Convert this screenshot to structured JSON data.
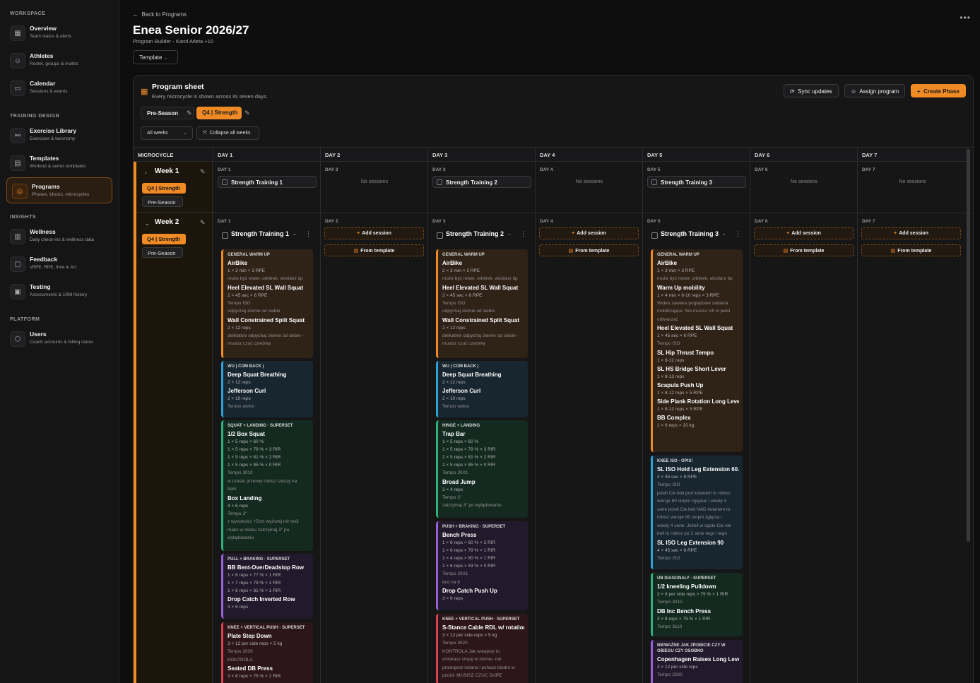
{
  "sidebar": {
    "workspace": "WORKSPACE",
    "training_design": "TRAINING DESIGN",
    "insights": "INSIGHTS",
    "platform": "PLATFORM",
    "items": [
      {
        "label": "Overview",
        "sub": "Team status & alerts",
        "icon": "grid-icon"
      },
      {
        "label": "Athletes",
        "sub": "Roster, groups & invites",
        "icon": "users-icon"
      },
      {
        "label": "Calendar",
        "sub": "Sessions & events",
        "icon": "calendar-icon"
      },
      {
        "label": "Exercise Library",
        "sub": "Exercises & taxonomy",
        "icon": "dumbbell-icon"
      },
      {
        "label": "Templates",
        "sub": "Workout & series templates",
        "icon": "template-icon"
      },
      {
        "label": "Programs",
        "sub": "Phases, blocks, microcycles",
        "icon": "target-icon"
      },
      {
        "label": "Wellness",
        "sub": "Daily check-ins & wellness data",
        "icon": "chart-icon"
      },
      {
        "label": "Feedback",
        "sub": "sRPE, RPE, time & AU",
        "icon": "message-icon"
      },
      {
        "label": "Testing",
        "sub": "Assessments & 1RM history",
        "icon": "clipboard-icon"
      },
      {
        "label": "Users",
        "sub": "Coach accounts & billing status",
        "icon": "shield-icon"
      }
    ]
  },
  "header": {
    "back": "Back to Programs",
    "title": "Enea Senior 2026/27",
    "subtitle": "Program Builder - Karol Atleta +10",
    "template": "Template"
  },
  "sheet": {
    "title": "Program sheet",
    "subtitle": "Every microcycle is shown across its seven days.",
    "sync": "Sync updates",
    "assign": "Assign program",
    "create": "Create Phase",
    "phase_a": "Pre-Season",
    "phase_b": "Q4 | Strength",
    "weeks_filter": "All weeks",
    "collapse": "Collapse all weeks"
  },
  "columns": [
    "MICROCYCLE",
    "DAY 1",
    "DAY 2",
    "DAY 3",
    "DAY 4",
    "DAY 5",
    "DAY 6",
    "DAY 7"
  ],
  "week1": {
    "label": "Week 1",
    "tag1": "Q4 | Strength",
    "tag2": "Pre-Season",
    "days": [
      "DAY 1",
      "DAY 2",
      "DAY 3",
      "DAY 4",
      "DAY 5",
      "DAY 6",
      "DAY 7"
    ],
    "s1": "Strength Training 1",
    "s2": "Strength Training 2",
    "s3": "Strength Training 3",
    "none": "No sessions"
  },
  "week2": {
    "label": "Week 2",
    "tag1": "Q4 | Strength",
    "tag2": "Pre-Season",
    "days": [
      "DAY 1",
      "DAY 2",
      "DAY 3",
      "DAY 4",
      "DAY 5",
      "DAY 6",
      "DAY 7"
    ],
    "add": "Add session",
    "from": "From template",
    "d1": {
      "title": "Strength Training 1"
    },
    "d3": {
      "title": "Strength Training 2"
    },
    "d5": {
      "title": "Strength Training 3"
    }
  },
  "blocks": {
    "d1b1": {
      "head": "GENERAL WARM UP",
      "lines": [
        [
          "ex",
          "AirBike"
        ],
        [
          "ln",
          "1 × 3 min × 3 RPE"
        ],
        [
          "nt",
          "może być rower, orbitrek, wioślarz itp"
        ],
        [
          "ex",
          "Heel Elevated SL Wall Squat"
        ],
        [
          "ln",
          "2 × 45 sec × 6 RPE"
        ],
        [
          "nt",
          "Tempo ISO"
        ],
        [
          "nt",
          "odpychaj ziemie od siebie"
        ],
        [
          "ex",
          "Wall Constrained Split Squat"
        ],
        [
          "ln",
          "2 × 12 reps"
        ],
        [
          "nt",
          "delikatnie odpychaj ziemie od siebie -"
        ],
        [
          "nt",
          "musisz czuć czwórkę"
        ]
      ]
    },
    "d1b2": {
      "head": "WU | COM BACK |",
      "lines": [
        [
          "ex",
          "Deep Squat Breathing"
        ],
        [
          "ln",
          "2 × 12 reps"
        ],
        [
          "ex",
          "Jefferson Curl"
        ],
        [
          "ln",
          "2 × 10 reps"
        ],
        [
          "nt",
          "Tempo wolno"
        ]
      ]
    },
    "d1b3": {
      "head": "SQUAT + LANDING · SUPERSET",
      "lines": [
        [
          "ex",
          "1/2 Box Squat"
        ],
        [
          "ln",
          "1 × 5 reps × 60 %"
        ],
        [
          "ln",
          "1 × 5 reps × 79 % × 3 RIR"
        ],
        [
          "ln",
          "1 × 5 reps × 81 % × 2 RIR"
        ],
        [
          "ln",
          "1 × 5 reps × 85 % × 0 RIR"
        ],
        [
          "nt",
          "Tempo 3010"
        ],
        [
          "nt",
          "w czasie przerwy robisz rzeczy na"
        ],
        [
          "nt",
          "bark"
        ],
        [
          "ex",
          "Box Landing"
        ],
        [
          "ln",
          "4 × 6 reps"
        ],
        [
          "nt",
          "Tempo 3\""
        ],
        [
          "nt",
          "z wysokości +5cm wyższej niż twój"
        ],
        [
          "nt",
          "maks w skoku zatrzymaj 3\" po"
        ],
        [
          "nt",
          "wylądowaniu"
        ]
      ]
    },
    "d1b4": {
      "head": "PULL + BRAKING · SUPERSET",
      "lines": [
        [
          "ex",
          "BB Bent-OverDeadstop Row"
        ],
        [
          "ln",
          "1 × 8 reps × 77 % × 1 RIR"
        ],
        [
          "ln",
          "1 × 7 reps × 79 % × 1 RIR"
        ],
        [
          "ln",
          "1 × 6 reps × 81 % × 1 RIR"
        ],
        [
          "ex",
          "Drop Catch Inverted Row"
        ],
        [
          "ln",
          "3 × 6 reps"
        ]
      ]
    },
    "d1b5": {
      "head": "KNEE + VERTICAL PUSH · SUPERSET",
      "lines": [
        [
          "ex",
          "Plate Step Down"
        ],
        [
          "ln",
          "3 × 12 per side reps × 5 kg"
        ],
        [
          "nt",
          "Tempo 2020"
        ],
        [
          "nt",
          "KONTROLA"
        ],
        [
          "ex",
          "Seated DB Press"
        ],
        [
          "ln",
          "3 × 8 reps × 75 % × 2 RIR"
        ]
      ]
    },
    "d3b1": {
      "head": "GENERAL WARM UP",
      "lines": [
        [
          "ex",
          "AirBike"
        ],
        [
          "ln",
          "2 × 3 min × 3 RPE"
        ],
        [
          "nt",
          "może być rower, orbitrek, wioślarz itp"
        ],
        [
          "ex",
          "Heel Elevated SL Wall Squat"
        ],
        [
          "ln",
          "2 × 45 sec × 6 RPE"
        ],
        [
          "nt",
          "Tempo ISO"
        ],
        [
          "nt",
          "odpychaj ziemie od siebie"
        ],
        [
          "ex",
          "Wall Constrained Split Squat"
        ],
        [
          "ln",
          "2 × 12 reps"
        ],
        [
          "nt",
          "delikatnie odpychaj ziemie od siebie -"
        ],
        [
          "nt",
          "musisz czuć czwórkę"
        ]
      ]
    },
    "d3b2": {
      "head": "WU | COM BACK |",
      "lines": [
        [
          "ex",
          "Deep Squat Breathing"
        ],
        [
          "ln",
          "2 × 12 reps"
        ],
        [
          "ex",
          "Jefferson Curl"
        ],
        [
          "ln",
          "2 × 10 reps"
        ],
        [
          "nt",
          "Tempo wolno"
        ]
      ]
    },
    "d3b3": {
      "head": "HINGE + LANDING",
      "lines": [
        [
          "ex",
          "Trap Bar"
        ],
        [
          "ln",
          "1 × 5 reps × 60 %"
        ],
        [
          "ln",
          "1 × 5 reps × 79 % × 3 RIR"
        ],
        [
          "ln",
          "1 × 5 reps × 81 % × 2 RIR"
        ],
        [
          "ln",
          "1 × 5 reps × 85 % × 0 RIR"
        ],
        [
          "nt",
          "Tempo 20X1"
        ],
        [
          "ex",
          "Broad Jump"
        ],
        [
          "ln",
          "3 × 4 reps"
        ],
        [
          "nt",
          "Tempo 3\""
        ],
        [
          "nt",
          "zatrzymaj 3\" po wylądowaniu"
        ]
      ]
    },
    "d3b4": {
      "head": "PUSH + BRAKING · SUPERSET",
      "lines": [
        [
          "ex",
          "Bench Press"
        ],
        [
          "ln",
          "1 × 6 reps × 60 % × 2 RIR"
        ],
        [
          "ln",
          "1 × 6 reps × 79 % × 1 RIR"
        ],
        [
          "ln",
          "1 × 4 reps × 80 % × 1 RIR"
        ],
        [
          "ln",
          "1 × 6 reps × 83 % × 0 RIR"
        ],
        [
          "nt",
          "Tempo 20X1"
        ],
        [
          "nt",
          "test na 6"
        ],
        [
          "ex",
          "Drop Catch Push Up"
        ],
        [
          "ln",
          "3 × 6 reps"
        ]
      ]
    },
    "d3b5": {
      "head": "KNEE + VERTICAL PUSH · SUPERSET",
      "lines": [
        [
          "ex",
          "S-Stance Cable RDL w/ rotation"
        ],
        [
          "ln",
          "3 × 12 per side reps × 5 kg"
        ],
        [
          "nt",
          "Tempo 3020"
        ],
        [
          "nt",
          "KONTROLA Jak wstajesz to"
        ],
        [
          "nt",
          "wciskasz stopę w ziemie- nie"
        ],
        [
          "nt",
          "prostujesz kolana i pchasz biodro w"
        ],
        [
          "nt",
          "przód- MUSISZ CZUC DUPE"
        ]
      ]
    },
    "d5b1": {
      "head": "GENERAL WARM UP",
      "lines": [
        [
          "ex",
          "AirBike"
        ],
        [
          "ln",
          "1 × 3 min × 3 RPE"
        ],
        [
          "nt",
          "może być rower, orbitrek, wioślarz itp"
        ],
        [
          "ex",
          "Warm Up mobility"
        ],
        [
          "ln",
          "1 × 4 min × 6-10 reps × 3 RPE"
        ],
        [
          "nt",
          "Wideo zawiera poglądowe zadania"
        ],
        [
          "nt",
          "mobilizujące. Nie musisz ich w pełni"
        ],
        [
          "nt",
          "odtwarzać"
        ],
        [
          "ex",
          "Heel Elevated SL Wall Squat"
        ],
        [
          "ln",
          "1 × 45 sec × 6 RPE"
        ],
        [
          "nt",
          "Tempo ISO"
        ],
        [
          "ex",
          "SL Hip Thrust Tempo"
        ],
        [
          "ln",
          "1 × 8-12 reps"
        ],
        [
          "ex",
          "SL HS Bridge Short Lever"
        ],
        [
          "ln",
          "1 × 8-12 reps"
        ],
        [
          "ex",
          "Scapula Push Up"
        ],
        [
          "ln",
          "1 × 8-12 reps × 5 RPE"
        ],
        [
          "ex",
          "Side Plank Rotation Long Lever"
        ],
        [
          "ln",
          "1 × 8-12 reps × 5 RPE"
        ],
        [
          "ex",
          "BB Complex"
        ],
        [
          "ln",
          "1 × 6 reps × 20 kg"
        ]
      ]
    },
    "d5b2": {
      "head": "KNEE ISO - OPIS!",
      "lines": [
        [
          "ex",
          "SL ISO Hold Leg Extension 60..."
        ],
        [
          "ln",
          "4 × 45 sec × 8 RPE"
        ],
        [
          "nt",
          "Tempo ISO"
        ],
        [
          "nt",
          "jeżeli Cie boli pod kolanem to robisz"
        ],
        [
          "nt",
          "wersje 60 stopni zgięcia! i wtedy 4"
        ],
        [
          "nt",
          "serie jeżeli Cie boli NAD kolanem to"
        ],
        [
          "nt",
          "robisz wersje 90 stopni zgięcia i"
        ],
        [
          "nt",
          "wtedy 4 serie. Jeżeli w ogóle Cie nie"
        ],
        [
          "nt",
          "boli to robisz po 2 serie tego i tego"
        ],
        [
          "ex",
          "SL ISO Leg Extension 90"
        ],
        [
          "ln",
          "4 × 45 sec × 8 RPE"
        ],
        [
          "nt",
          "Tempo ISO"
        ]
      ]
    },
    "d5b3": {
      "head": "UB DIAGONALY · SUPERSET",
      "lines": [
        [
          "ex",
          "1/2 kneeling Pulldown"
        ],
        [
          "ln",
          "3 × 8 per side reps × 79 % × 1 RIR"
        ],
        [
          "nt",
          "Tempo 3010"
        ],
        [
          "ex",
          "DB Inc Bench Press"
        ],
        [
          "ln",
          "3 × 8 reps × 79 % × 1 RIR"
        ],
        [
          "nt",
          "Tempo 3110"
        ]
      ]
    },
    "d5b4": {
      "head": "NIEWAŻNE JAK ZROBICIE CZY W OBIEGU CZY OSOBNO",
      "lines": [
        [
          "ex",
          "Copenhagen Raises Long Lever"
        ],
        [
          "ln",
          "3 × 12 per side reps"
        ],
        [
          "nt",
          "Tempo 2020"
        ]
      ]
    }
  }
}
